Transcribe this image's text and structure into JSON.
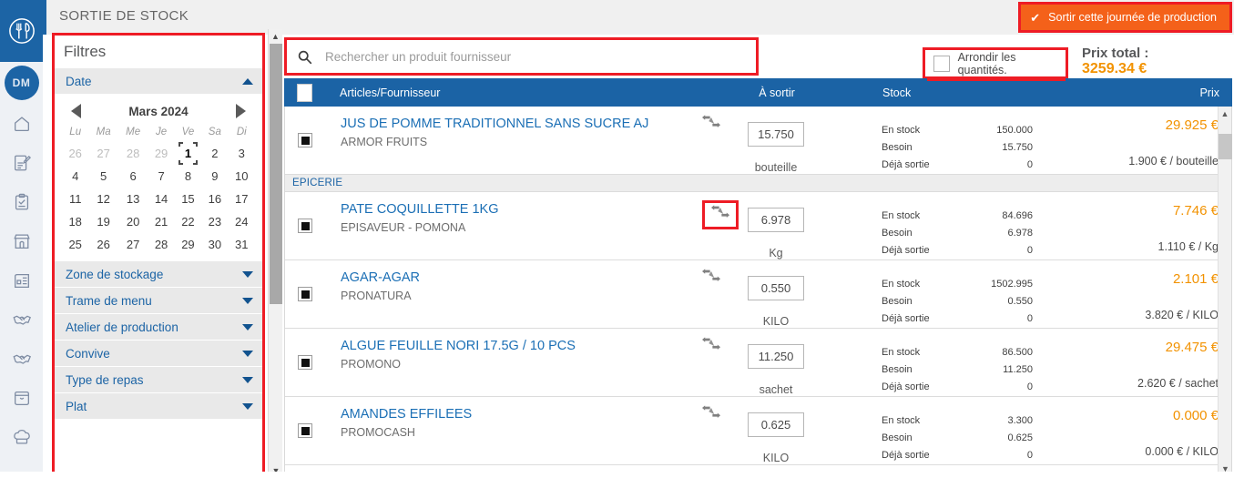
{
  "app": {
    "title": "SORTIE DE STOCK",
    "brand_blue": "#1c64a5",
    "accent_orange": "#f29200",
    "highlight_red": "#ee1c25",
    "logo_icon": "restaurant-cutlery-icon",
    "avatar_initials": "DM"
  },
  "rail": {
    "items": [
      {
        "icon": "home-icon",
        "name": "home"
      },
      {
        "icon": "edit-document-icon",
        "name": "menus"
      },
      {
        "icon": "clipboard-check-icon",
        "name": "tasks"
      },
      {
        "icon": "storefront-icon",
        "name": "restaurant"
      },
      {
        "icon": "receipt-building-icon",
        "name": "invoices"
      },
      {
        "icon": "handshake-icon",
        "name": "suppliers"
      },
      {
        "icon": "handshake-icon",
        "name": "contracts"
      },
      {
        "icon": "box-icon",
        "name": "stock"
      },
      {
        "icon": "chef-hat-icon",
        "name": "production"
      }
    ]
  },
  "action_button": {
    "label": "Sortir cette journée de production",
    "icon": "check-icon"
  },
  "filters": {
    "title": "Filtres",
    "date_section": {
      "label": "Date",
      "expanded": true,
      "caret": "caret-up-icon"
    },
    "calendar": {
      "month_label": "Mars 2024",
      "prev_icon": "triangle-left-icon",
      "next_icon": "triangle-right-icon",
      "weekdays": [
        "Lu",
        "Ma",
        "Me",
        "Je",
        "Ve",
        "Sa",
        "Di"
      ],
      "weeks": [
        [
          {
            "d": "26",
            "muted": true
          },
          {
            "d": "27",
            "muted": true
          },
          {
            "d": "28",
            "muted": true
          },
          {
            "d": "29",
            "muted": true
          },
          {
            "d": "1",
            "selected": true
          },
          {
            "d": "2"
          },
          {
            "d": "3"
          }
        ],
        [
          {
            "d": "4"
          },
          {
            "d": "5"
          },
          {
            "d": "6"
          },
          {
            "d": "7"
          },
          {
            "d": "8"
          },
          {
            "d": "9"
          },
          {
            "d": "10"
          }
        ],
        [
          {
            "d": "11"
          },
          {
            "d": "12"
          },
          {
            "d": "13"
          },
          {
            "d": "14"
          },
          {
            "d": "15"
          },
          {
            "d": "16"
          },
          {
            "d": "17"
          }
        ],
        [
          {
            "d": "18"
          },
          {
            "d": "19"
          },
          {
            "d": "20"
          },
          {
            "d": "21"
          },
          {
            "d": "22"
          },
          {
            "d": "23"
          },
          {
            "d": "24"
          }
        ],
        [
          {
            "d": "25"
          },
          {
            "d": "26"
          },
          {
            "d": "27"
          },
          {
            "d": "28"
          },
          {
            "d": "29"
          },
          {
            "d": "30"
          },
          {
            "d": "31"
          }
        ]
      ]
    },
    "sections": [
      {
        "label": "Zone de stockage",
        "caret": "caret-down-icon"
      },
      {
        "label": "Trame de menu",
        "caret": "caret-down-icon"
      },
      {
        "label": "Atelier de production",
        "caret": "caret-down-icon"
      },
      {
        "label": "Convive",
        "caret": "caret-down-icon"
      },
      {
        "label": "Type de repas",
        "caret": "caret-down-icon"
      },
      {
        "label": "Plat",
        "caret": "caret-down-icon"
      }
    ]
  },
  "search": {
    "value": "",
    "placeholder": "Rechercher un produit fournisseur",
    "icon": "search-icon"
  },
  "rounding": {
    "label": "Arrondir les quantités.",
    "checked": false
  },
  "total": {
    "label": "Prix total :",
    "value": "3259.34 €"
  },
  "table": {
    "headers": {
      "articles": "Articles/Fournisseur",
      "a_sortir": "À sortir",
      "stock": "Stock",
      "prix": "Prix"
    },
    "select_all_checked": false,
    "stock_labels": {
      "en_stock": "En stock",
      "besoin": "Besoin",
      "deja_sortie": "Déjà sortie"
    },
    "rows": [
      {
        "kind": "item",
        "checked": true,
        "name": "JUS DE POMME TRADITIONNEL SANS SUCRE AJ",
        "supplier": "ARMOR FRUITS",
        "swap_icon": "exchange-arrows-icon",
        "swap_highlighted": false,
        "qty": "15.750",
        "unit": "bouteille",
        "en_stock": "150.000",
        "besoin": "15.750",
        "deja_sortie": "0",
        "price": "29.925 €",
        "unit_price": "1.900 € / bouteille"
      },
      {
        "kind": "group",
        "label": "EPICERIE"
      },
      {
        "kind": "item",
        "checked": true,
        "name": "PATE COQUILLETTE 1KG",
        "supplier": "EPISAVEUR - POMONA",
        "swap_icon": "exchange-arrows-icon",
        "swap_highlighted": true,
        "qty": "6.978",
        "unit": "Kg",
        "en_stock": "84.696",
        "besoin": "6.978",
        "deja_sortie": "0",
        "price": "7.746 €",
        "unit_price": "1.110 € / Kg"
      },
      {
        "kind": "item",
        "checked": true,
        "name": "AGAR-AGAR",
        "supplier": "PRONATURA",
        "swap_icon": "exchange-arrows-icon",
        "swap_highlighted": false,
        "qty": "0.550",
        "unit": "KILO",
        "en_stock": "1502.995",
        "besoin": "0.550",
        "deja_sortie": "0",
        "price": "2.101 €",
        "unit_price": "3.820 € / KILO"
      },
      {
        "kind": "item",
        "checked": true,
        "name": "ALGUE FEUILLE NORI 17.5G / 10 PCS",
        "supplier": "PROMONO",
        "swap_icon": "exchange-arrows-icon",
        "swap_highlighted": false,
        "qty": "11.250",
        "unit": "sachet",
        "en_stock": "86.500",
        "besoin": "11.250",
        "deja_sortie": "0",
        "price": "29.475 €",
        "unit_price": "2.620 € / sachet"
      },
      {
        "kind": "item",
        "checked": true,
        "name": "AMANDES EFFILEES",
        "supplier": "PROMOCASH",
        "swap_icon": "exchange-arrows-icon",
        "swap_highlighted": false,
        "qty": "0.625",
        "unit": "KILO",
        "en_stock": "3.300",
        "besoin": "0.625",
        "deja_sortie": "0",
        "price": "0.000 €",
        "unit_price": "0.000 € / KILO"
      }
    ]
  }
}
